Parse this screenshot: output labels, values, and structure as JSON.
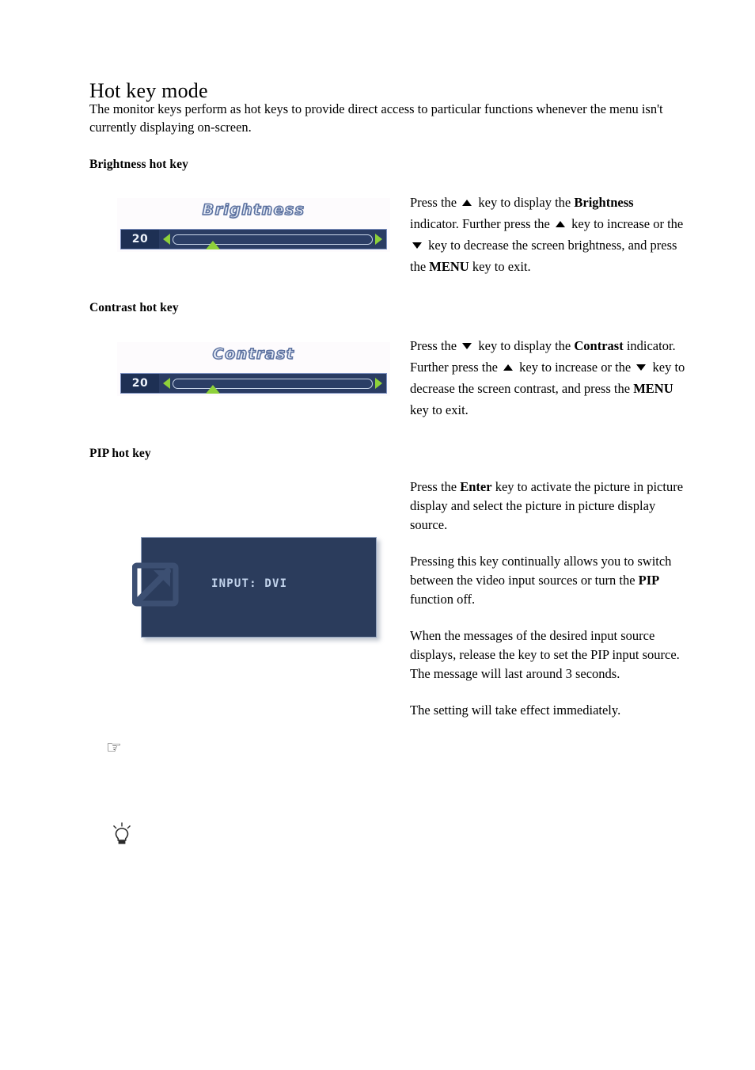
{
  "page": {
    "heading": "Hot key mode",
    "intro": "The monitor keys perform as hot keys to provide direct access to particular functions whenever the menu isn't currently displaying on-screen."
  },
  "sections": {
    "brightness": {
      "subheading": "Brightness hot key",
      "osd": {
        "title": "Brightness",
        "value": "20",
        "left_arrow": "left-arrow-icon",
        "right_arrow": "right-arrow-icon",
        "thumb_position_percent": 20
      },
      "instructions": {
        "t1": "Press the ",
        "key1": "up-arrow-key-icon",
        "t2": " key to display the ",
        "term1": "Brightness",
        "t3": " indicator. Further press the ",
        "key2": "up-arrow-key-icon",
        "t4": " key to increase or the ",
        "key3": "down-arrow-key-icon",
        "t5": " key to decrease the screen brightness, and press the ",
        "term2": "MENU",
        "t6": " key to exit."
      }
    },
    "contrast": {
      "subheading": "Contrast hot key",
      "osd": {
        "title": "Contrast",
        "value": "20",
        "left_arrow": "left-arrow-icon",
        "right_arrow": "right-arrow-icon",
        "thumb_position_percent": 20
      },
      "instructions": {
        "t1": "Press the ",
        "key1": "down-arrow-key-icon",
        "t2": " key to display the ",
        "term1": "Contrast",
        "t3": " indicator. Further press the ",
        "key2": "up-arrow-key-icon",
        "t4": " key to increase or the ",
        "key3": "down-arrow-key-icon",
        "t5": " key to decrease the screen contrast, and press the ",
        "term2": "MENU",
        "t6": " key to exit."
      }
    },
    "pip": {
      "subheading": "PIP hot key",
      "message_box": {
        "icon": "input-source-arrow-icon",
        "text": "INPUT: DVI"
      },
      "paragraphs": {
        "p1_a": "Press the ",
        "p1_term": "Enter",
        "p1_b": " key to activate the picture in picture display and select the picture in picture display source.",
        "p2_a": "Pressing this key continually allows you to switch between the video input sources or turn the ",
        "p2_term": "PIP",
        "p2_b": " function off.",
        "p3": "When the messages of the desired input source displays, release the key to set the PIP input source. The message will last around 3 seconds.",
        "p4": "The setting will take effect immediately."
      }
    }
  },
  "notes": {
    "hand_icon": "pointing-hand-icon",
    "hand_glyph": "☞",
    "tip_icon": "lightbulb-tip-icon"
  },
  "colors": {
    "osd_bar_bg": "#2a3c63",
    "osd_value_bg": "#1e3054",
    "osd_accent_green": "#8ed13a",
    "osd_border": "#7b8fc0",
    "pip_box_bg": "#2b3c5c",
    "pip_text": "#c3d4ec",
    "page_bg": "#ffffff",
    "text": "#000000"
  }
}
